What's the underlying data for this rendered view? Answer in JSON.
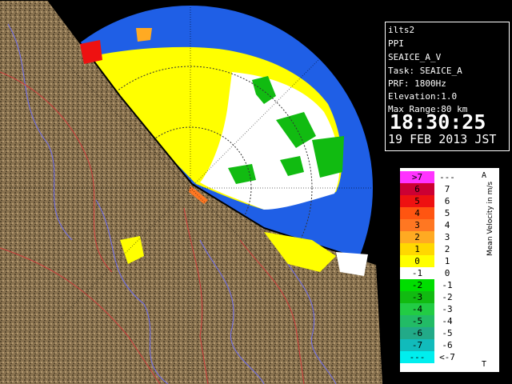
{
  "info": {
    "station": "ilts2",
    "product": "PPI",
    "scan": "SEAICE_A_V",
    "task": "Task: SEAICE_A",
    "prf": "PRF: 1800Hz",
    "elevation": "Elevation:1.0",
    "max_range": "Max Range:80 km",
    "time": "18:30:25",
    "date": "19 FEB 2013 JST"
  },
  "legend": {
    "title": "Mean Velocity in m/s",
    "axis_top": "A",
    "axis_bottom": "T",
    "rows": [
      {
        "left": ">7",
        "right": "---",
        "color": "#ff33ff",
        "text": "#000"
      },
      {
        "left": "6",
        "right": "7",
        "color": "#cc0033",
        "text": "#000"
      },
      {
        "left": "5",
        "right": "6",
        "color": "#ee1111",
        "text": "#000"
      },
      {
        "left": "4",
        "right": "5",
        "color": "#ff5511",
        "text": "#000"
      },
      {
        "left": "3",
        "right": "4",
        "color": "#ff7722",
        "text": "#000"
      },
      {
        "left": "2",
        "right": "3",
        "color": "#ffaa22",
        "text": "#000"
      },
      {
        "left": "1",
        "right": "2",
        "color": "#ffd800",
        "text": "#000"
      },
      {
        "left": "0",
        "right": "1",
        "color": "#ffff00",
        "text": "#000"
      },
      {
        "left": "-1",
        "right": "0",
        "color": "#ffffff",
        "text": "#000"
      },
      {
        "left": "-2",
        "right": "-1",
        "color": "#00dd00",
        "text": "#000"
      },
      {
        "left": "-3",
        "right": "-2",
        "color": "#11bb11",
        "text": "#000"
      },
      {
        "left": "-4",
        "right": "-3",
        "color": "#22cc44",
        "text": "#000"
      },
      {
        "left": "-5",
        "right": "-4",
        "color": "#22bb66",
        "text": "#000"
      },
      {
        "left": "-6",
        "right": "-5",
        "color": "#22aa88",
        "text": "#000"
      },
      {
        "left": "-7",
        "right": "-6",
        "color": "#11bbbb",
        "text": "#000"
      },
      {
        "left": "---",
        "right": "<-7",
        "color": "#00eeee",
        "text": "#000"
      }
    ]
  },
  "colors": {
    "background": "#000000",
    "range_disk": "#1f5fe6",
    "land": "#8a7350",
    "approaching": "#ffff00",
    "receding": "#ffffff",
    "green": "#11bb11"
  }
}
